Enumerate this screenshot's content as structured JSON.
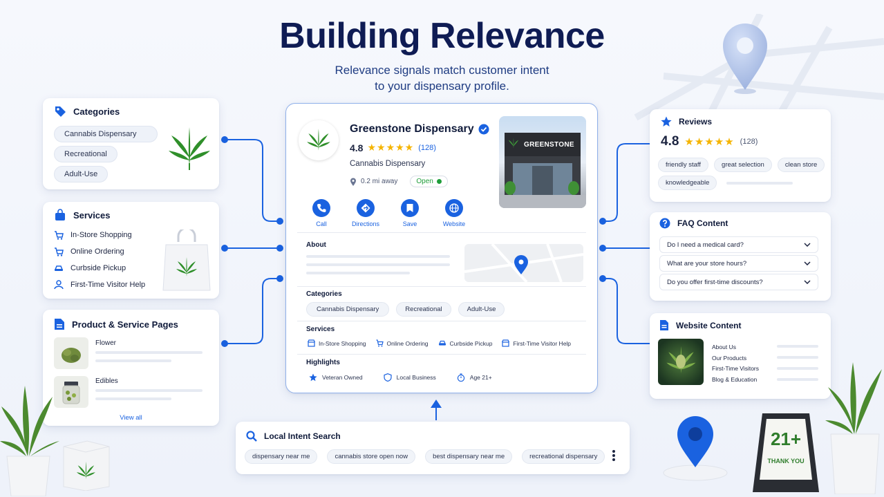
{
  "header": {
    "title": "Building Relevance",
    "subtitle_line1": "Relevance signals match customer intent",
    "subtitle_line2": "to your dispensary profile."
  },
  "colors": {
    "accent": "#1a62e0",
    "title": "#0f1c54",
    "open_green": "#1f9d3a",
    "star": "#f5b400"
  },
  "categories_card": {
    "title": "Categories",
    "items": [
      "Cannabis Dispensary",
      "Recreational",
      "Adult-Use"
    ]
  },
  "services_card": {
    "title": "Services",
    "items": [
      {
        "label": "In-Store Shopping",
        "icon": "cart-icon"
      },
      {
        "label": "Online Ordering",
        "icon": "cart-icon"
      },
      {
        "label": "Curbside Pickup",
        "icon": "car-icon"
      },
      {
        "label": "First-Time Visitor Help",
        "icon": "person-icon"
      }
    ]
  },
  "pages_card": {
    "title": "Product & Service Pages",
    "items": [
      "Flower",
      "Edibles"
    ],
    "view_all": "View all"
  },
  "profile": {
    "name": "Greenstone Dispensary",
    "rating": "4.8",
    "review_count": "(128)",
    "category": "Cannabis Dispensary",
    "distance": "0.2 mi away",
    "status": "Open",
    "storefront_sign": "GREENSTONE",
    "actions": [
      "Call",
      "Directions",
      "Save",
      "Website"
    ],
    "about_label": "About",
    "categories_label": "Categories",
    "categories": [
      "Cannabis Dispensary",
      "Recreational",
      "Adult-Use"
    ],
    "services_label": "Services",
    "services": [
      "In-Store Shopping",
      "Online Ordering",
      "Curbside Pickup",
      "First-Time Visitor Help"
    ],
    "highlights_label": "Highlights",
    "highlights": [
      "Veteran Owned",
      "Local Business",
      "Age 21+"
    ]
  },
  "reviews_card": {
    "title": "Reviews",
    "rating": "4.8",
    "count": "(128)",
    "tags": [
      "friendly staff",
      "great selection",
      "clean store",
      "knowledgeable"
    ]
  },
  "faq_card": {
    "title": "FAQ Content",
    "items": [
      "Do I need a medical card?",
      "What are your store hours?",
      "Do you offer first-time discounts?"
    ]
  },
  "website_card": {
    "title": "Website Content",
    "items": [
      "About Us",
      "Our Products",
      "First-Time Visitors",
      "Blog & Education"
    ]
  },
  "search_card": {
    "title": "Local Intent Search",
    "queries": [
      "dispensary near me",
      "cannabis store open now",
      "best dispensary near me",
      "recreational dispensary"
    ]
  },
  "sign": {
    "big": "21+",
    "small": "THANK YOU"
  }
}
